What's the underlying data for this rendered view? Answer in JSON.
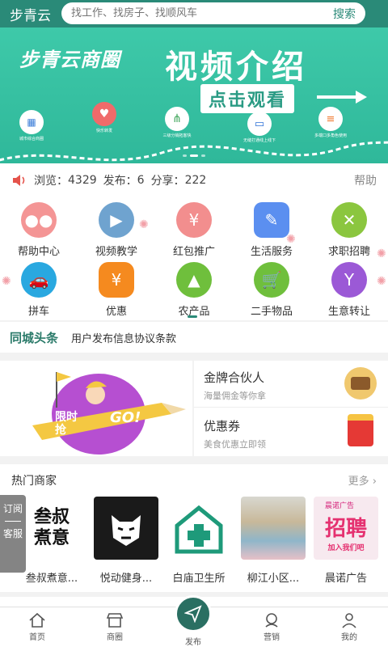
{
  "header": {
    "title": "步青云",
    "search_placeholder": "找工作、找房子、找顺风车",
    "search_button": "搜索"
  },
  "banner": {
    "brand": "步青云商圈",
    "headline": "视频介绍",
    "cta": "点击观看",
    "nodes": [
      "城市综合商圈",
      "快乐转发",
      "三级分销拓客快",
      "无缝打通线上线下",
      "多端口多角色使用"
    ]
  },
  "stats": {
    "views_label": "浏览：",
    "views": "4329",
    "posts_label": "发布：",
    "posts": "6",
    "shares_label": "分享：",
    "shares": "222",
    "help": "帮助"
  },
  "grid": [
    {
      "label": "帮助中心",
      "icon": "chat-icon",
      "color": "#f27c7c"
    },
    {
      "label": "视频教学",
      "icon": "tv-icon",
      "color": "#4a8fc9"
    },
    {
      "label": "红包推广",
      "icon": "card-icon",
      "color": "#f27c7c"
    },
    {
      "label": "生活服务",
      "icon": "broom-icon",
      "color": "#5b8ff0"
    },
    {
      "label": "求职招聘",
      "icon": "tools-icon",
      "color": "#8bc63f"
    },
    {
      "label": "拼车",
      "icon": "car-icon",
      "color": "#29a8e0"
    },
    {
      "label": "优惠",
      "icon": "ticket-icon",
      "color": "#f58a1f"
    },
    {
      "label": "农产品",
      "icon": "mountain-icon",
      "color": "#6fbf3c"
    },
    {
      "label": "二手物品",
      "icon": "cart-icon",
      "color": "#6fbf3c"
    },
    {
      "label": "生意转让",
      "icon": "cocktail-icon",
      "color": "#9b59d6"
    }
  ],
  "headline": {
    "tag": "同城头条",
    "text": "用户发布信息协议条款"
  },
  "promo": {
    "left_badge": "限时抢",
    "left_go": "GO!",
    "right": [
      {
        "title": "金牌合伙人",
        "sub": "海量佣金等你拿"
      },
      {
        "title": "优惠券",
        "sub": "美食优惠立即领"
      }
    ]
  },
  "merchants": {
    "title": "热门商家",
    "more": "更多 ›",
    "items": [
      {
        "name": "叁叔煮意...",
        "thumb_text": "叁叔煮意"
      },
      {
        "name": "悦动健身...",
        "thumb_text": ""
      },
      {
        "name": "白庙卫生所",
        "thumb_text": ""
      },
      {
        "name": "柳江小区...",
        "thumb_text": ""
      },
      {
        "name": "晨诺广告",
        "thumb_text": "招聘",
        "thumb_caption": "晨诺广告",
        "thumb_sub": "加入我们吧"
      }
    ]
  },
  "side_tab": {
    "subscribe": "订阅",
    "service": "客服"
  },
  "tabbar": [
    {
      "label": "首页",
      "icon": "home-icon"
    },
    {
      "label": "商圈",
      "icon": "shop-icon"
    },
    {
      "label": "发布",
      "icon": "send-icon"
    },
    {
      "label": "营销",
      "icon": "marketing-icon"
    },
    {
      "label": "我的",
      "icon": "user-icon"
    }
  ],
  "colors": {
    "primary": "#2a8a78",
    "banner": "#3ec9a9"
  }
}
